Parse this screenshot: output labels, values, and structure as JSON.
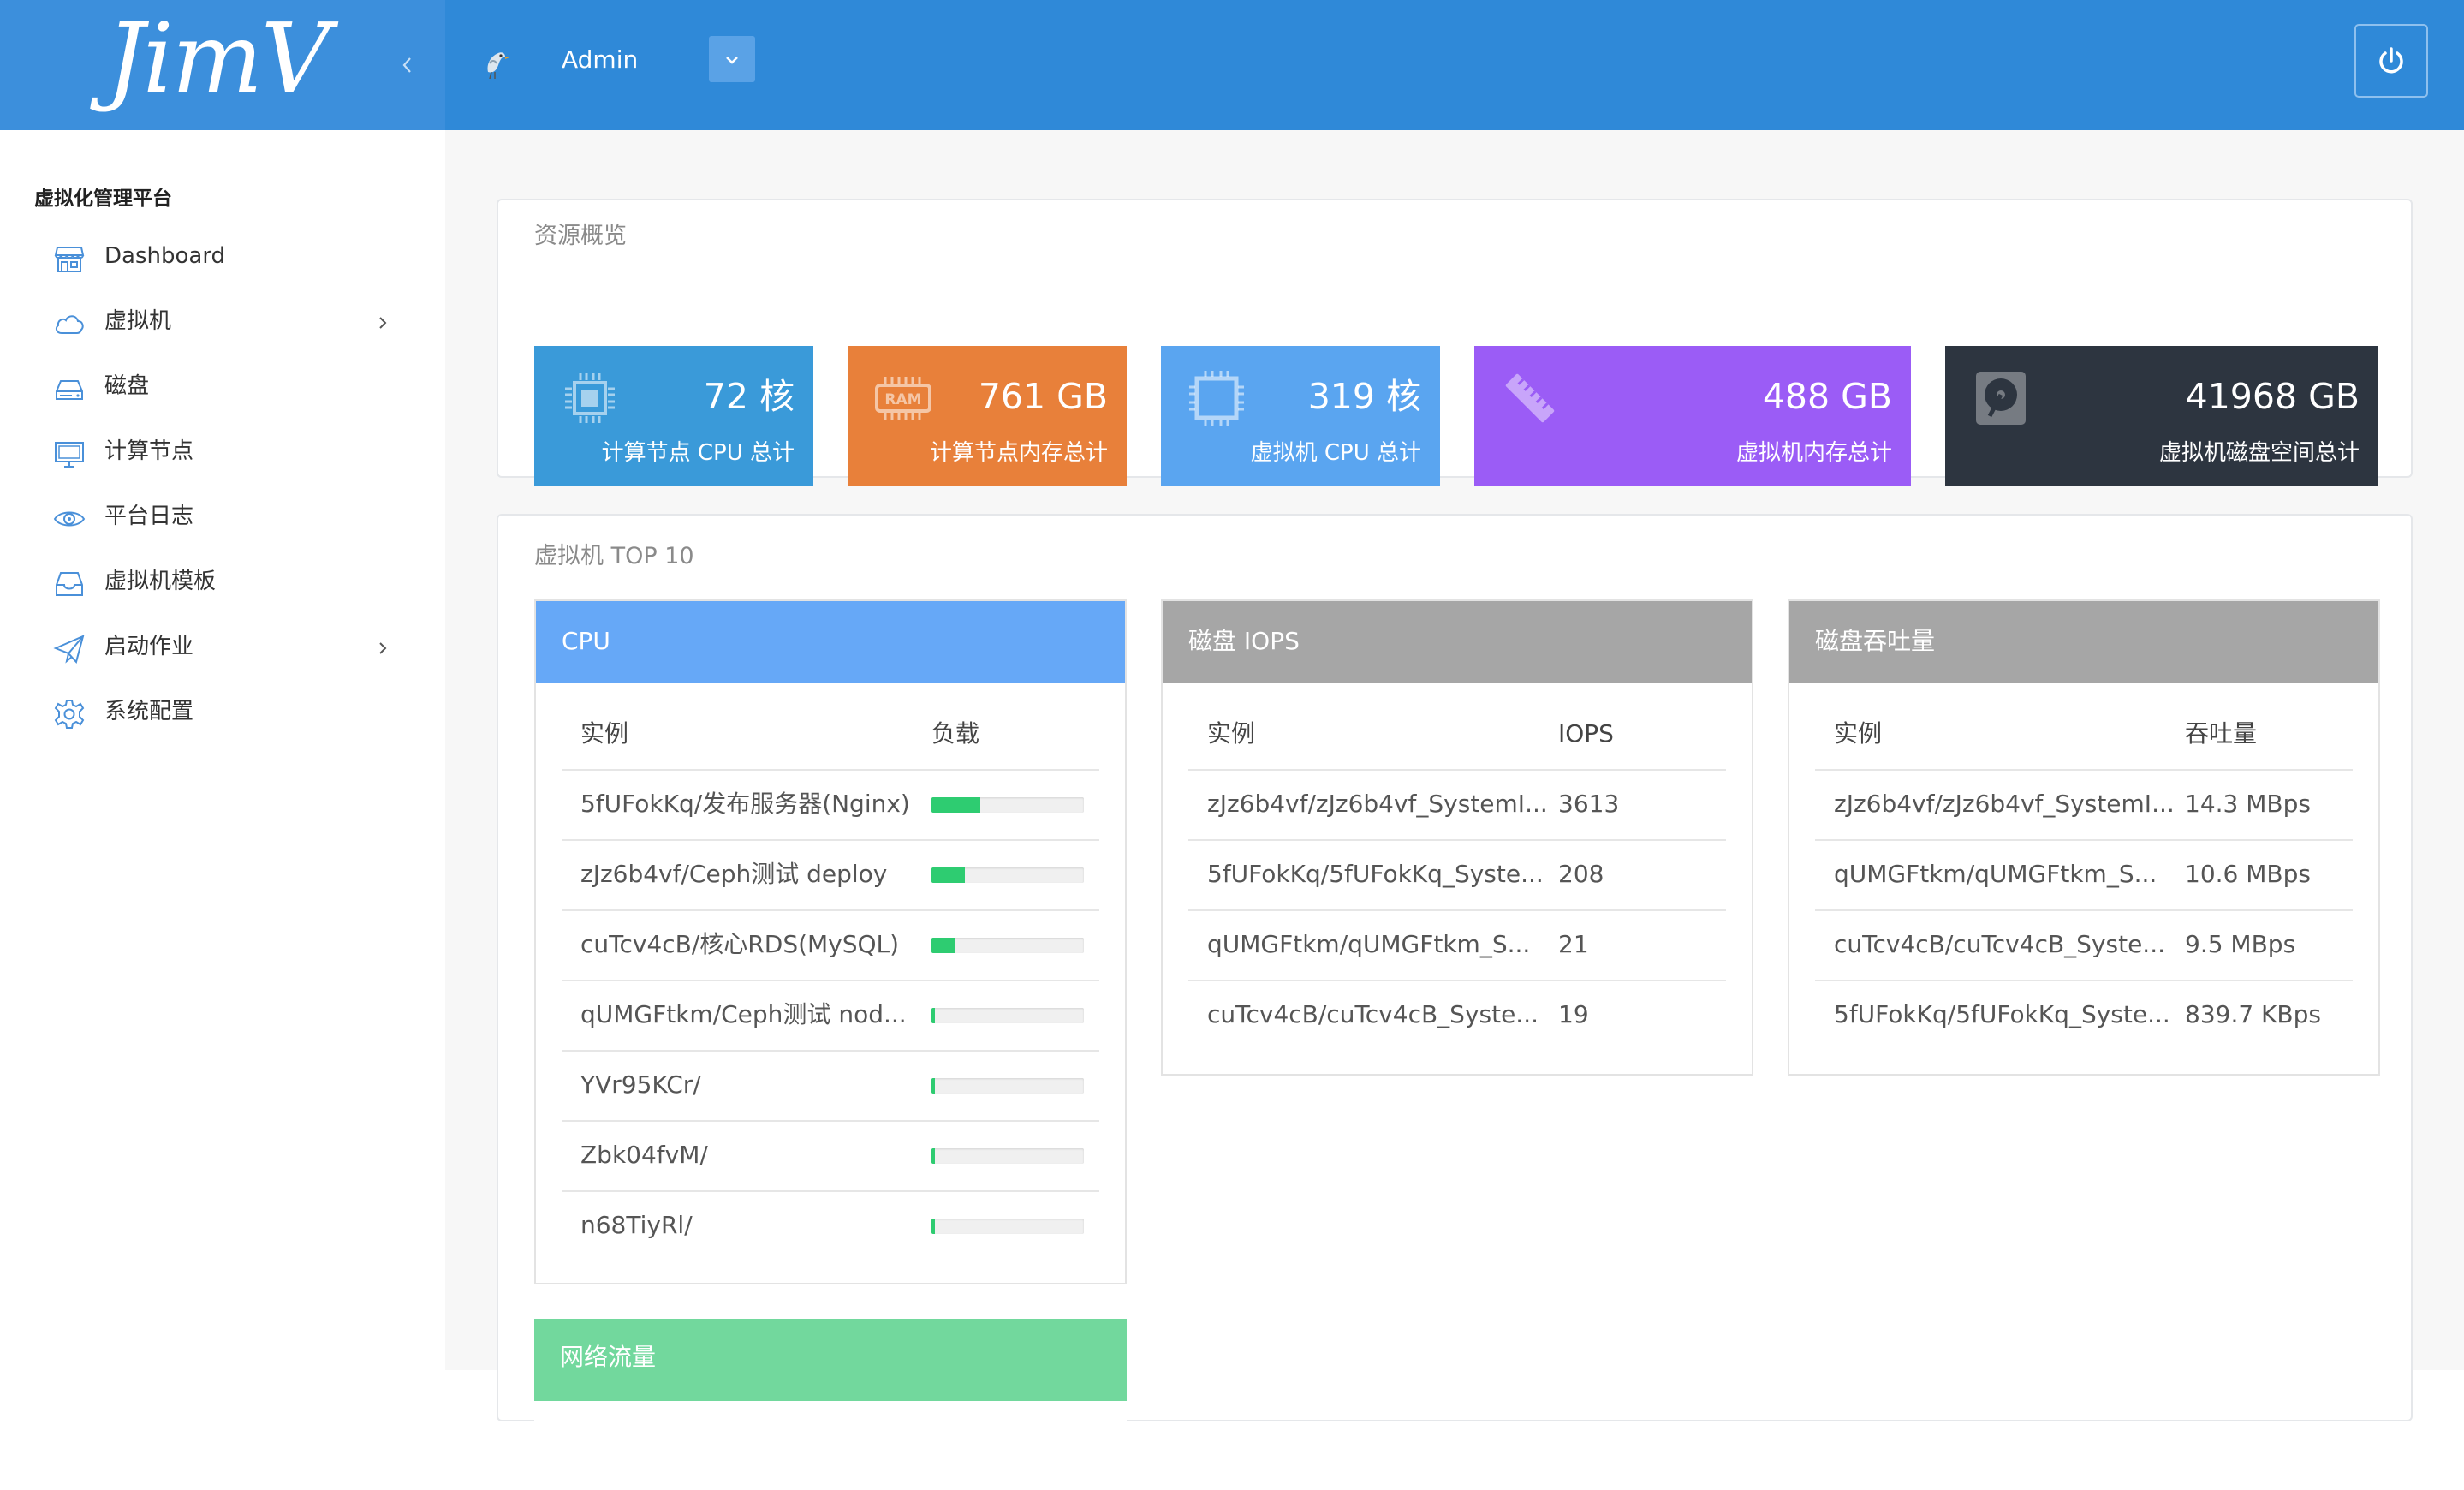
{
  "header": {
    "logo": "JimV",
    "user_name": "Admin"
  },
  "sidebar": {
    "title": "虚拟化管理平台",
    "items": [
      {
        "label": "Dashboard",
        "icon": "store-icon",
        "has_submenu": false
      },
      {
        "label": "虚拟机",
        "icon": "cloud-icon",
        "has_submenu": true
      },
      {
        "label": "磁盘",
        "icon": "hard-drive-icon",
        "has_submenu": false
      },
      {
        "label": "计算节点",
        "icon": "monitor-icon",
        "has_submenu": false
      },
      {
        "label": "平台日志",
        "icon": "eye-icon",
        "has_submenu": false
      },
      {
        "label": "虚拟机模板",
        "icon": "inbox-icon",
        "has_submenu": false
      },
      {
        "label": "启动作业",
        "icon": "paper-plane-icon",
        "has_submenu": true
      },
      {
        "label": "系统配置",
        "icon": "gear-icon",
        "has_submenu": false
      }
    ]
  },
  "overview": {
    "title": "资源概览",
    "cards": [
      {
        "value": "72 核",
        "label": "计算节点 CPU 总计",
        "color": "#3a9ad9",
        "icon": "cpu-chip-icon"
      },
      {
        "value": "761 GB",
        "label": "计算节点内存总计",
        "color": "#e8803a",
        "icon": "ram-icon"
      },
      {
        "value": "319 核",
        "label": "虚拟机 CPU 总计",
        "color": "#5aa5f0",
        "icon": "vcpu-chip-icon"
      },
      {
        "value": "488 GB",
        "label": "虚拟机内存总计",
        "color": "#9b5cf6",
        "icon": "memory-stick-icon"
      },
      {
        "value": "41968 GB",
        "label": "虚拟机磁盘空间总计",
        "color": "#2d3540",
        "icon": "disk-icon"
      }
    ]
  },
  "top10": {
    "title": "虚拟机 TOP 10",
    "cpu": {
      "header": "CPU",
      "header_color": "#66a8f7",
      "col1": "实例",
      "col2": "负载",
      "rows": [
        {
          "name": "5fUFokKq/发布服务器(Nginx)",
          "load": 0.32
        },
        {
          "name": "zJz6b4vf/Ceph测试 deploy",
          "load": 0.22
        },
        {
          "name": "cuTcv4cB/核心RDS(MySQL)",
          "load": 0.16
        },
        {
          "name": "qUMGFtkm/Ceph测试 nod...",
          "load": 0.02
        },
        {
          "name": "YVr95KCr/",
          "load": 0.02
        },
        {
          "name": "Zbk04fvM/",
          "load": 0.02
        },
        {
          "name": "n68TiyRl/",
          "load": 0.02
        }
      ]
    },
    "disk_iops": {
      "header": "磁盘 IOPS",
      "header_color": "#a6a6a6",
      "col1": "实例",
      "col2": "IOPS",
      "rows": [
        {
          "name": "zJz6b4vf/zJz6b4vf_SystemI...",
          "value": "3613"
        },
        {
          "name": "5fUFokKq/5fUFokKq_Syste...",
          "value": "208"
        },
        {
          "name": "qUMGFtkm/qUMGFtkm_S...",
          "value": "21"
        },
        {
          "name": "cuTcv4cB/cuTcv4cB_Syste...",
          "value": "19"
        }
      ]
    },
    "disk_throughput": {
      "header": "磁盘吞吐量",
      "header_color": "#a6a6a6",
      "col1": "实例",
      "col2": "吞吐量",
      "rows": [
        {
          "name": "zJz6b4vf/zJz6b4vf_SystemI...",
          "value": "14.3 MBps"
        },
        {
          "name": "qUMGFtkm/qUMGFtkm_S...",
          "value": "10.6 MBps"
        },
        {
          "name": "cuTcv4cB/cuTcv4cB_Syste...",
          "value": "9.5 MBps"
        },
        {
          "name": "5fUFokKq/5fUFokKq_Syste...",
          "value": "839.7 KBps"
        }
      ]
    },
    "network": {
      "header": "网络流量",
      "header_color": "#72d89d"
    }
  }
}
